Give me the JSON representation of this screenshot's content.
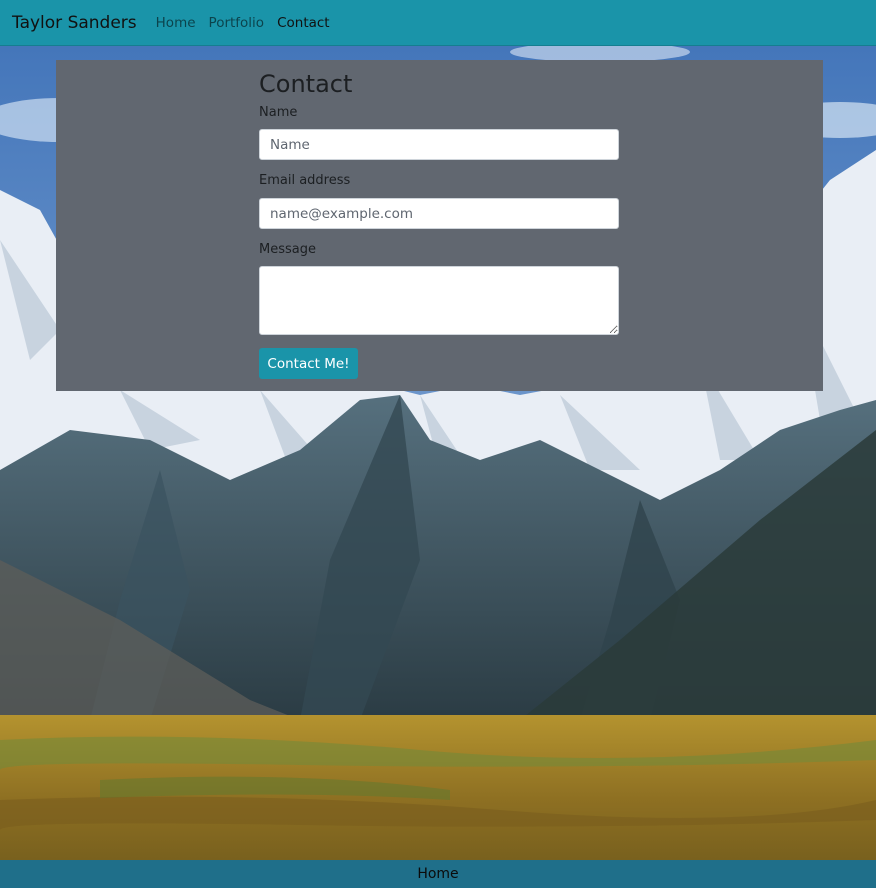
{
  "navbar": {
    "brand": "Taylor Sanders",
    "links": [
      {
        "label": "Home",
        "active": false
      },
      {
        "label": "Portfolio",
        "active": false
      },
      {
        "label": "Contact",
        "active": true
      }
    ]
  },
  "contact": {
    "title": "Contact",
    "name_label": "Name",
    "name_placeholder": "Name",
    "name_value": "",
    "email_label": "Email address",
    "email_placeholder": "name@example.com",
    "email_value": "",
    "message_label": "Message",
    "message_value": "",
    "submit_label": "Contact Me!"
  },
  "footer": {
    "link_label": "Home"
  },
  "background": {
    "subject": "snow-capped mountain range above autumn tundra",
    "colors": {
      "sky": "#5b86c3",
      "snow": "#eef2f7",
      "rock": "#3e5562",
      "tundra": "#a07d2a"
    }
  },
  "colors": {
    "accent": "#1a94a9",
    "panel": "#616770",
    "footer": "#1f6f8a"
  }
}
